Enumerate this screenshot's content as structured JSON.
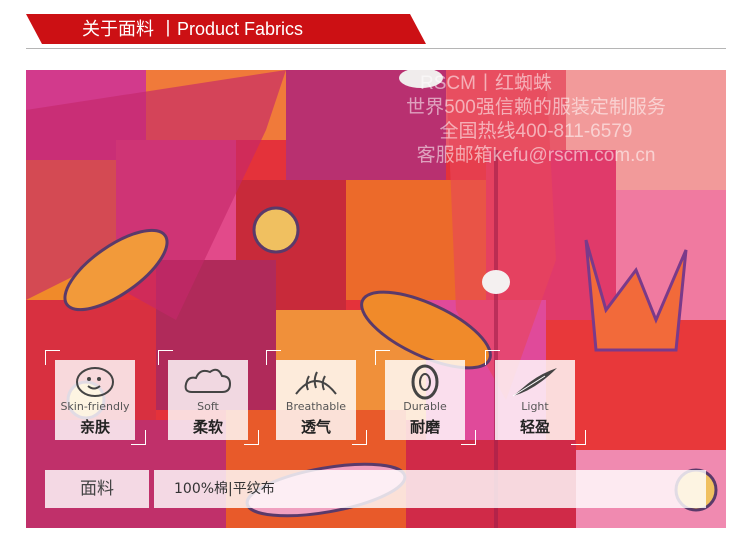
{
  "header": {
    "title": "关于面料 丨Product Fabrics"
  },
  "watermark": {
    "line1": "RSCM丨红蜘蛛",
    "line2": "世界500强信赖的服装定制服务",
    "line3": "全国热线400-811-6579",
    "line4": "客服邮箱kefu@rscm.com.cn"
  },
  "features": [
    {
      "en": "Skin-friendly",
      "zh": "亲肤",
      "icon": "baby-icon"
    },
    {
      "en": "Soft",
      "zh": "柔软",
      "icon": "cloud-icon"
    },
    {
      "en": "Breathable",
      "zh": "透气",
      "icon": "steam-icon"
    },
    {
      "en": "Durable",
      "zh": "耐磨",
      "icon": "tire-icon"
    },
    {
      "en": "Light",
      "zh": "轻盈",
      "icon": "feather-icon"
    }
  ],
  "fabric": {
    "label": "面料",
    "value": "100%棉|平纹布"
  },
  "colors": {
    "brand_red": "#cc1014"
  }
}
